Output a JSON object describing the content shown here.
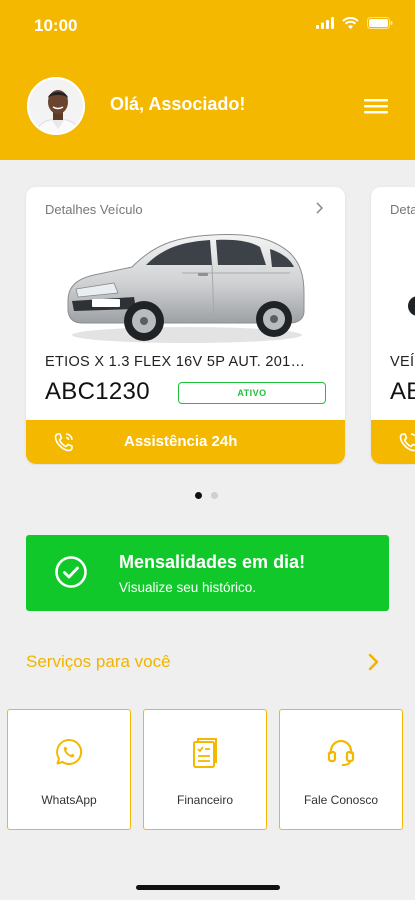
{
  "status_bar": {
    "time": "10:00"
  },
  "header": {
    "greeting": "Olá, Associado!"
  },
  "vehicle_cards": [
    {
      "title": "Detalhes Veículo",
      "model": "ETIOS X 1.3 FLEX 16V 5P AUT. 201…",
      "plate": "ABC1230",
      "status": "ATIVO",
      "assist_label": "Assistência 24h"
    },
    {
      "title": "Deta",
      "model": "VEÍ",
      "plate": "AB"
    }
  ],
  "carousel": {
    "page_count": 2,
    "active_index": 0
  },
  "payment_status": {
    "title": "Mensalidades em dia!",
    "subtitle": "Visualize seu histórico."
  },
  "services": {
    "header": "Serviços para você",
    "items": [
      {
        "label": "WhatsApp",
        "icon": "whatsapp-icon"
      },
      {
        "label": "Financeiro",
        "icon": "document-icon"
      },
      {
        "label": "Fale Conosco",
        "icon": "headset-icon"
      }
    ]
  },
  "colors": {
    "brand": "#f5b800",
    "success": "#11c82a",
    "background": "#efefef"
  }
}
